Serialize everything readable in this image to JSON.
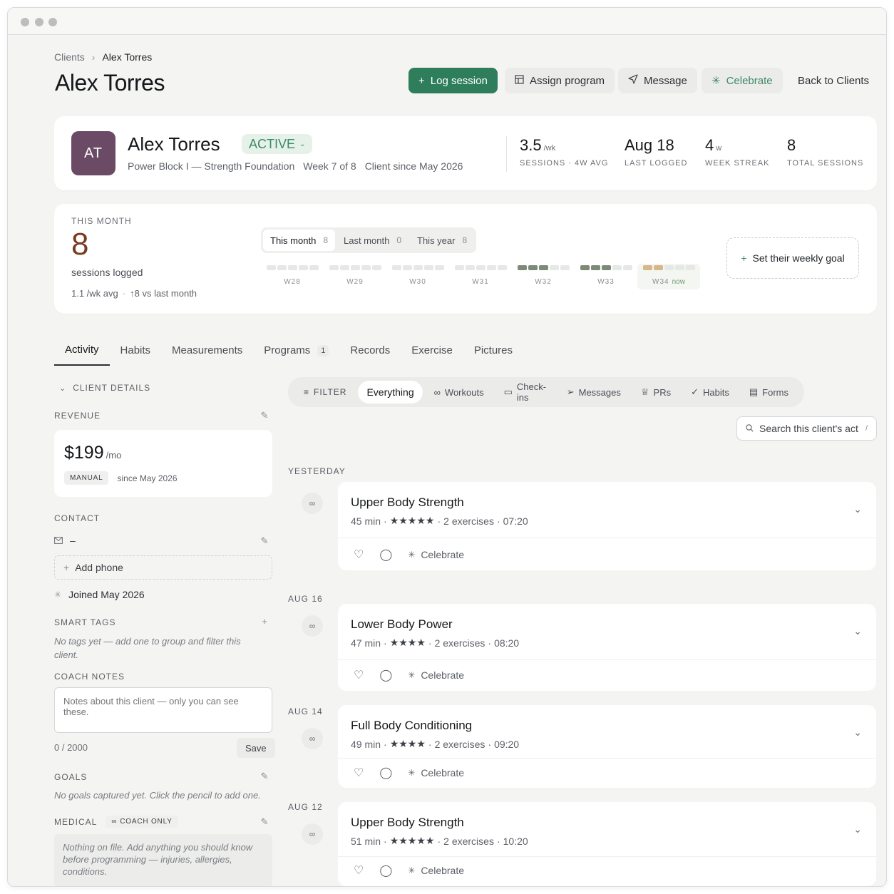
{
  "breadcrumb": {
    "parent": "Clients",
    "sep": "›",
    "current": "Alex Torres"
  },
  "header": {
    "title": "Alex Torres",
    "buttons": {
      "log_session": "Log session",
      "assign_program": "Assign program",
      "message": "Message",
      "celebrate": "Celebrate",
      "back": "Back to Clients"
    }
  },
  "profile": {
    "initials": "AT",
    "name": "Alex Torres",
    "status": "ACTIVE",
    "program": "Power Block I — Strength Foundation",
    "week": "Week 7 of 8",
    "since": "Client since May 2026",
    "stats": [
      {
        "value": "3.5",
        "unit": "/wk",
        "label": "SESSIONS · 4W AVG"
      },
      {
        "value": "Aug 18",
        "unit": "",
        "label": "LAST LOGGED"
      },
      {
        "value": "4",
        "unit": "w",
        "label": "WEEK STREAK"
      },
      {
        "value": "8",
        "unit": "",
        "label": "TOTAL SESSIONS"
      }
    ]
  },
  "month": {
    "label": "THIS MONTH",
    "value": "8",
    "sub": "sessions logged",
    "avg": "1.1 /wk avg",
    "dot": "·",
    "delta": "↑8 vs last month",
    "periods": [
      {
        "label": "This month",
        "count": "8"
      },
      {
        "label": "Last month",
        "count": "0"
      },
      {
        "label": "This year",
        "count": "8"
      }
    ],
    "weeks": [
      {
        "label": "W28",
        "sessions": 0
      },
      {
        "label": "W29",
        "sessions": 0
      },
      {
        "label": "W30",
        "sessions": 0
      },
      {
        "label": "W31",
        "sessions": 0
      },
      {
        "label": "W32",
        "sessions": 3
      },
      {
        "label": "W33",
        "sessions": 3
      },
      {
        "label": "W34",
        "sessions": 2,
        "now": "now"
      }
    ],
    "goal_button": "Set their weekly goal"
  },
  "tabs": [
    {
      "label": "Activity"
    },
    {
      "label": "Habits"
    },
    {
      "label": "Measurements"
    },
    {
      "label": "Programs",
      "count": "1"
    },
    {
      "label": "Records"
    },
    {
      "label": "Exercise"
    },
    {
      "label": "Pictures"
    }
  ],
  "sidebar": {
    "client_details": "CLIENT DETAILS",
    "revenue_label": "REVENUE",
    "revenue_amount": "$199",
    "revenue_unit": "/mo",
    "revenue_tag": "MANUAL",
    "revenue_since": "since May 2026",
    "contact_label": "CONTACT",
    "email": "–",
    "add_phone": "Add phone",
    "joined": "Joined May 2026",
    "tags_label": "SMART TAGS",
    "tags_empty": "No tags yet — add one to group and filter this client.",
    "notes_label": "COACH NOTES",
    "notes_placeholder": "Notes about this client — only you can see these.",
    "notes_count": "0 / 2000",
    "save": "Save",
    "goals_label": "GOALS",
    "goals_empty": "No goals captured yet. Click the pencil to add one.",
    "medical_label": "MEDICAL",
    "coach_only": "COACH ONLY",
    "medical_empty": "Nothing on file. Add anything you should know before programming — injuries, allergies, conditions."
  },
  "filters": {
    "filter_label": "FILTER",
    "items": [
      "Everything",
      "Workouts",
      "Check-ins",
      "Messages",
      "PRs",
      "Habits",
      "Forms"
    ],
    "search_placeholder": "Search this client's act",
    "search_shortcut": "/"
  },
  "feed": [
    {
      "date": "YESTERDAY",
      "title": "Upper Body Strength",
      "duration": "45 min",
      "stars": "★★★★★",
      "exercises": "2 exercises",
      "time": "07:20",
      "celebrate": "Celebrate"
    },
    {
      "date": "AUG 16",
      "title": "Lower Body Power",
      "duration": "47 min",
      "stars": "★★★★",
      "exercises": "2 exercises",
      "time": "08:20",
      "celebrate": "Celebrate"
    },
    {
      "date": "AUG 14",
      "title": "Full Body Conditioning",
      "duration": "49 min",
      "stars": "★★★★",
      "exercises": "2 exercises",
      "time": "09:20",
      "celebrate": "Celebrate"
    },
    {
      "date": "AUG 12",
      "title": "Upper Body Strength",
      "duration": "51 min",
      "stars": "★★★★★",
      "exercises": "2 exercises",
      "time": "10:20",
      "celebrate": "Celebrate"
    }
  ],
  "colors": {
    "accent": "#2e7d5b",
    "avatar": "#6b4a66",
    "big_number": "#7a3b22",
    "active_week": "#7d8a78",
    "current_week": "#d6b88a"
  }
}
